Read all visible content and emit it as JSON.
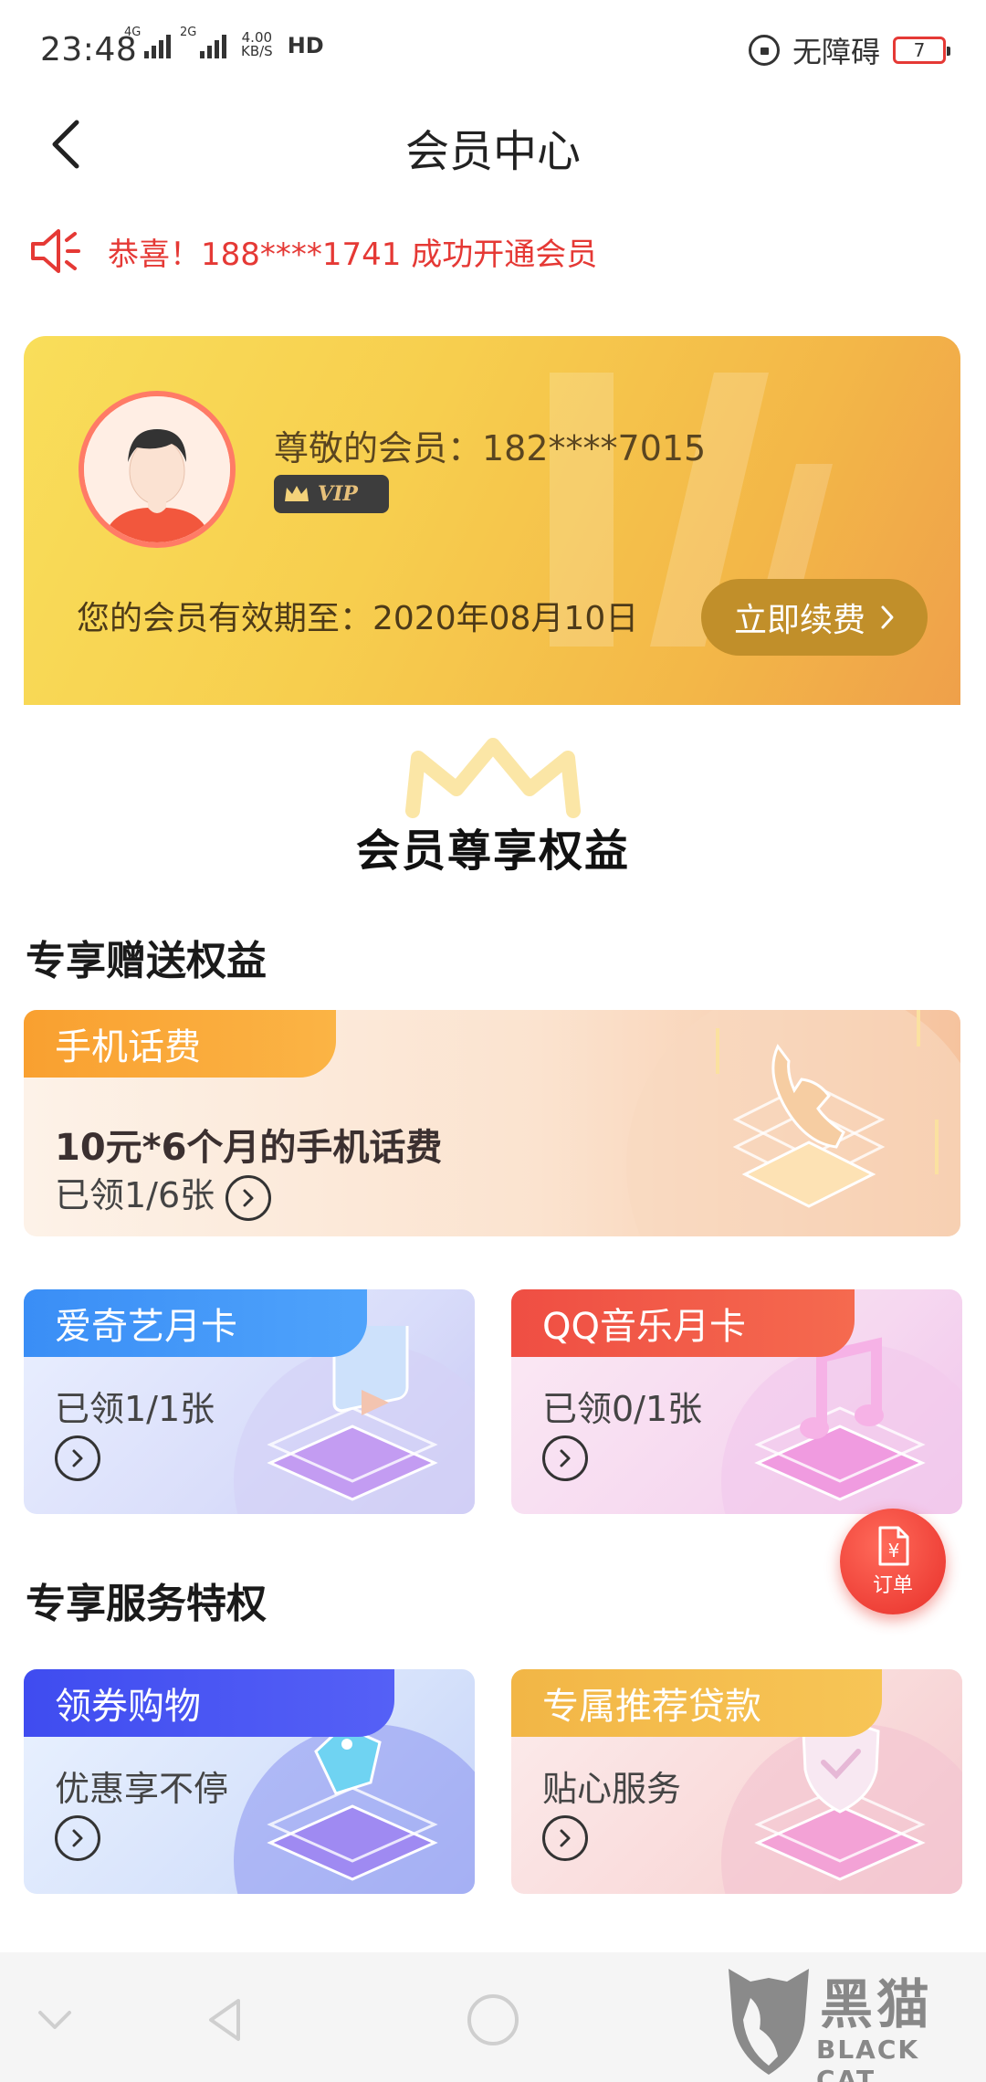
{
  "status_bar": {
    "time": "23:48",
    "network_1": "4G",
    "network_2": "2G",
    "speed_value": "4.00",
    "speed_unit": "KB/S",
    "hd": "HD",
    "accessibility": "无障碍",
    "battery": "7"
  },
  "header": {
    "title": "会员中心"
  },
  "notice": {
    "text": "恭喜！188****1741 成功开通会员"
  },
  "member_card": {
    "name": "尊敬的会员：182****7015",
    "badge": "VIP",
    "expiry": "您的会员有效期至：2020年08月10日",
    "renew_label": "立即续费"
  },
  "benefits": {
    "title": "会员尊享权益"
  },
  "gift_section": {
    "title": "专享赠送权益",
    "phone_card": {
      "tag": "手机话费",
      "headline": "10元*6个月的手机话费",
      "status": "已领1/6张"
    },
    "iqiyi_card": {
      "tag": "爱奇艺月卡",
      "status": "已领1/1张"
    },
    "qqmusic_card": {
      "tag": "QQ音乐月卡",
      "status": "已领0/1张"
    }
  },
  "service_section": {
    "title": "专享服务特权",
    "coupon_card": {
      "tag": "领券购物",
      "desc": "优惠享不停"
    },
    "loan_card": {
      "tag": "专属推荐贷款",
      "desc": "贴心服务"
    }
  },
  "order_button": {
    "symbol": "¥",
    "label": "订单"
  },
  "watermark": {
    "cn": "黑猫",
    "en": "BLACK CAT"
  },
  "colors": {
    "accent_red": "#e53935",
    "gold": "#c18f2a",
    "tag_orange": "#f9a030",
    "tag_blue": "#3a8ef6",
    "tag_red": "#ef4e43",
    "tag_indigo": "#4050f0",
    "tag_amber": "#f2b646"
  }
}
